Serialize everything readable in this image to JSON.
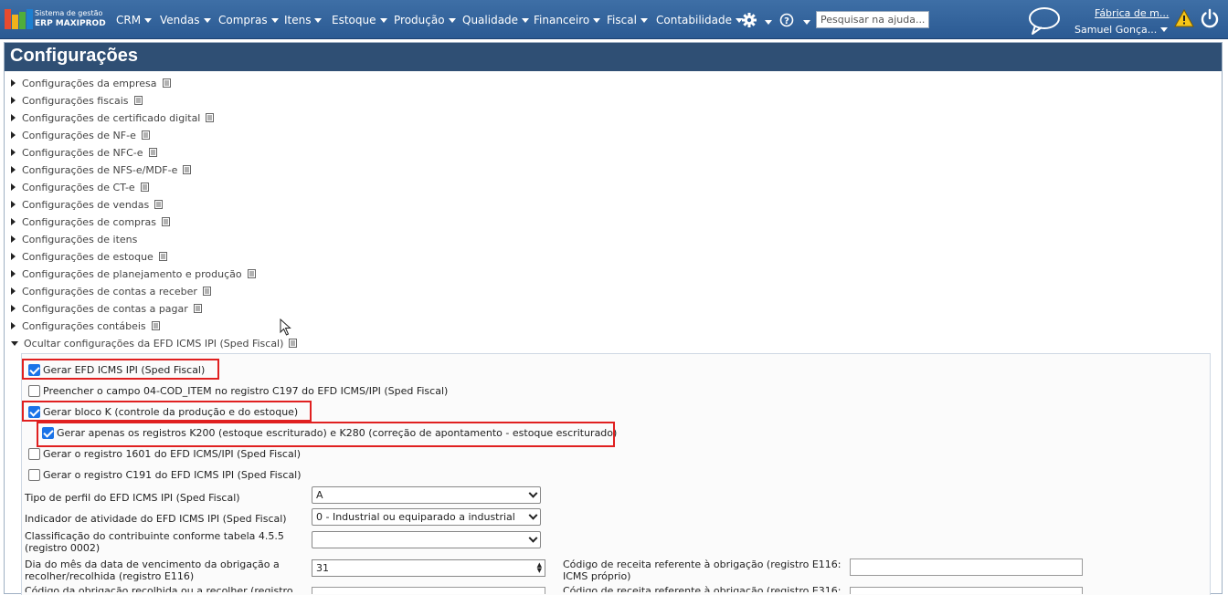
{
  "app": {
    "logo_subtitle": "Sistema de gestão",
    "logo_name": "ERP MAXIPROD",
    "menus": [
      "CRM",
      "Vendas",
      "Compras",
      "Itens",
      "Estoque",
      "Produção",
      "Qualidade",
      "Financeiro",
      "Fiscal",
      "Contabilidade"
    ],
    "search_placeholder": "Pesquisar na ajuda...",
    "company": "Fábrica de m...",
    "user": "Samuel Gonça..."
  },
  "colors": {
    "topbar": "#2b5a93",
    "header": "#2f4f74",
    "highlight": "#e02020",
    "checkbox": "#1a73e8"
  },
  "page": {
    "title": "Configurações",
    "sections": [
      "Configurações da empresa",
      "Configurações fiscais",
      "Configurações de certificado digital",
      "Configurações de NF-e",
      "Configurações de NFC-e",
      "Configurações de NFS-e/MDF-e",
      "Configurações de CT-e",
      "Configurações de vendas",
      "Configurações de compras",
      "Configurações de itens",
      "Configurações de estoque",
      "Configurações de planejamento e produção",
      "Configurações de contas a receber",
      "Configurações de contas a pagar",
      "Configurações contábeis"
    ],
    "expanded_section": "Ocultar configurações da EFD ICMS IPI (Sped Fiscal)"
  },
  "efd": {
    "checkboxes": [
      {
        "label": "Gerar EFD ICMS IPI (Sped Fiscal)",
        "checked": true
      },
      {
        "label": "Preencher o campo 04-COD_ITEM no registro C197 do EFD ICMS/IPI (Sped Fiscal)",
        "checked": false
      },
      {
        "label": "Gerar bloco K (controle da produção e do estoque)",
        "checked": true
      },
      {
        "label": "Gerar apenas os registros K200 (estoque escriturado) e K280 (correção de apontamento - estoque escriturado)",
        "checked": true
      },
      {
        "label": "Gerar o registro 1601 do EFD ICMS/IPI (Sped Fiscal)",
        "checked": false
      },
      {
        "label": "Gerar o registro C191 do EFD ICMS IPI (Sped Fiscal)",
        "checked": false
      }
    ],
    "perfil_label": "Tipo de perfil do EFD ICMS IPI (Sped Fiscal)",
    "perfil_value": "A",
    "atividade_label": "Indicador de atividade do EFD ICMS IPI (Sped Fiscal)",
    "atividade_value": "0 - Industrial ou equiparado a industrial",
    "classificacao_label": "Classificação do contribuinte conforme tabela 4.5.5 (registro 0002)",
    "classificacao_value": "",
    "dia_label": "Dia do mês da data de vencimento da obrigação a recolher/recolhida (registro E116)",
    "dia_value": "31",
    "receita_label": "Código de receita referente à obrigação (registro E116: ICMS próprio)",
    "receita_value": "",
    "cut_left_label": "Código da obrigação recolhida ou a recolher (registro",
    "cut_right_label": "Código de receita referente à obrigação (registro E316:"
  }
}
